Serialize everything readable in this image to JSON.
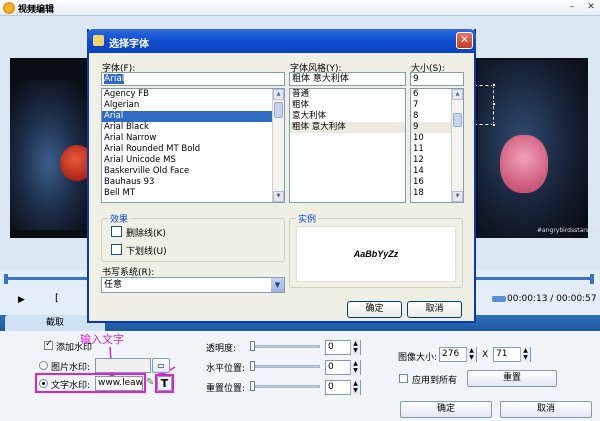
{
  "window": {
    "title": "视频编辑",
    "minimize_label": "–",
    "close_label": "✕"
  },
  "preview": {
    "watermark_text": "#angrybirdsstarwars"
  },
  "timeline": {
    "time": "00:00:13 / 00:00:57"
  },
  "tabs": {
    "crop_label": "截取"
  },
  "panel": {
    "add_watermark_label": "添加水印",
    "image_watermark_label": "图片水印:",
    "text_watermark_label": "文字水印:",
    "text_watermark_value": "www.leaw",
    "annotation": "输入文字",
    "transparency_label": "透明度:",
    "transparency_value": "0",
    "h_pos_label": "水平位置:",
    "h_pos_value": "0",
    "repeat_pos_label": "重置位置:",
    "repeat_pos_value": "0",
    "image_size_label": "图像大小:",
    "image_width": "276",
    "image_x": "X",
    "image_height": "71",
    "apply_all_label": "应用到所有",
    "reset_label": "重置",
    "ok_label": "确定",
    "cancel_label": "取消",
    "font_button_label": "T"
  },
  "dialog": {
    "title": "选择字体",
    "font_label": "字体(F):",
    "font_value": "Arial",
    "fonts": [
      "Agency FB",
      "Algerian",
      "Arial",
      "Arial Black",
      "Arial Narrow",
      "Arial Rounded MT Bold",
      "Arial Unicode MS",
      "Baskerville Old Face",
      "Bauhaus 93",
      "Bell MT"
    ],
    "selected_font": "Arial",
    "style_label": "字体风格(Y):",
    "style_value": "粗体 意大利体",
    "styles": [
      "普通",
      "粗体",
      "意大利体",
      "粗体 意大利体"
    ],
    "selected_style": "粗体 意大利体",
    "size_label": "大小(S):",
    "size_value": "9",
    "sizes": [
      "6",
      "7",
      "8",
      "9",
      "10",
      "11",
      "12",
      "14",
      "16",
      "18"
    ],
    "selected_size": "9",
    "effects_label": "效果",
    "strikeout_label": "删除线(K)",
    "underline_label": "下划线(U)",
    "sample_label": "实例",
    "sample_text": "AaBbYyZz",
    "script_label": "书写系统(R):",
    "script_value": "任意",
    "ok_label": "确定",
    "cancel_label": "取消",
    "close_label": "✕"
  },
  "colors": {
    "accent": "#0a43c0",
    "selection": "#316ac5",
    "annotation": "#e020d0",
    "tab_bar": "#1d5aa0"
  }
}
